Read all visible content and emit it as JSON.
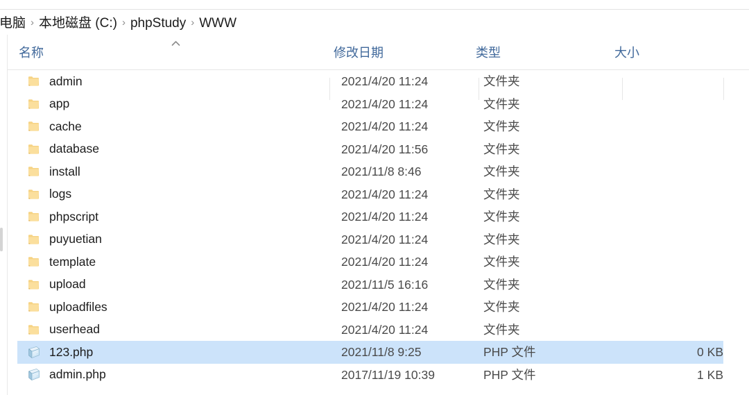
{
  "window": {
    "breadcrumb": {
      "separator": "›",
      "items": [
        "电脑",
        "本地磁盘 (C:)",
        "phpStudy",
        "WWW"
      ]
    }
  },
  "columns": {
    "sort_indicator": "ascending-caret",
    "headers": [
      {
        "label": "名称",
        "key": "name"
      },
      {
        "label": "修改日期",
        "key": "date"
      },
      {
        "label": "类型",
        "key": "type"
      },
      {
        "label": "大小",
        "key": "size"
      }
    ]
  },
  "colors": {
    "selection": "#cce3fa",
    "header_text": "#41699b",
    "folder_icon": "#f7d58a",
    "php_icon": "#bfe0f5"
  },
  "files": [
    {
      "name": "admin",
      "date": "2021/4/20 11:24",
      "type": "文件夹",
      "size": "",
      "icon": "folder-icon",
      "selected": false
    },
    {
      "name": "app",
      "date": "2021/4/20 11:24",
      "type": "文件夹",
      "size": "",
      "icon": "folder-icon",
      "selected": false
    },
    {
      "name": "cache",
      "date": "2021/4/20 11:24",
      "type": "文件夹",
      "size": "",
      "icon": "folder-icon",
      "selected": false
    },
    {
      "name": "database",
      "date": "2021/4/20 11:56",
      "type": "文件夹",
      "size": "",
      "icon": "folder-icon",
      "selected": false
    },
    {
      "name": "install",
      "date": "2021/11/8 8:46",
      "type": "文件夹",
      "size": "",
      "icon": "folder-icon",
      "selected": false
    },
    {
      "name": "logs",
      "date": "2021/4/20 11:24",
      "type": "文件夹",
      "size": "",
      "icon": "folder-icon",
      "selected": false
    },
    {
      "name": "phpscript",
      "date": "2021/4/20 11:24",
      "type": "文件夹",
      "size": "",
      "icon": "folder-icon",
      "selected": false
    },
    {
      "name": "puyuetian",
      "date": "2021/4/20 11:24",
      "type": "文件夹",
      "size": "",
      "icon": "folder-icon",
      "selected": false
    },
    {
      "name": "template",
      "date": "2021/4/20 11:24",
      "type": "文件夹",
      "size": "",
      "icon": "folder-icon",
      "selected": false
    },
    {
      "name": "upload",
      "date": "2021/11/5 16:16",
      "type": "文件夹",
      "size": "",
      "icon": "folder-icon",
      "selected": false
    },
    {
      "name": "uploadfiles",
      "date": "2021/4/20 11:24",
      "type": "文件夹",
      "size": "",
      "icon": "folder-icon",
      "selected": false
    },
    {
      "name": "userhead",
      "date": "2021/4/20 11:24",
      "type": "文件夹",
      "size": "",
      "icon": "folder-icon",
      "selected": false
    },
    {
      "name": "123.php",
      "date": "2021/11/8 9:25",
      "type": "PHP 文件",
      "size": "0 KB",
      "icon": "php-file-icon",
      "selected": true
    },
    {
      "name": "admin.php",
      "date": "2017/11/19 10:39",
      "type": "PHP 文件",
      "size": "1 KB",
      "icon": "php-file-icon",
      "selected": false
    }
  ]
}
